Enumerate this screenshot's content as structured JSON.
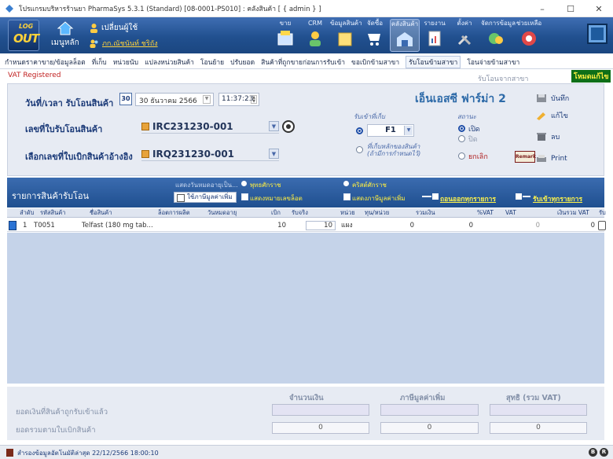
{
  "window": {
    "title": "โปรแกรมบริหารร้านยา PharmaSys 5.3.1 (Standard) [08-0001-PS010] : คลังสินค้า [ { admin } ]",
    "controls": {
      "minimize": "–",
      "maximize": "☐",
      "close": "✕"
    }
  },
  "toolbar": {
    "logout": {
      "line1": "LOG",
      "line2": "OUT"
    },
    "home_label": "เมนูหลัก",
    "change_user": "เปลี่ยนผู้ใช้",
    "current_user": "ภก.ณัชนันท์ ชริถัง",
    "buttons": [
      {
        "label": "ขาย",
        "icon": "sales-icon"
      },
      {
        "label": "CRM",
        "icon": "crm-icon"
      },
      {
        "label": "ข้อมูลสินค้า",
        "icon": "product-icon"
      },
      {
        "label": "จัดซื้อ",
        "icon": "purchase-icon"
      },
      {
        "label": "คลังสินค้า",
        "icon": "warehouse-icon"
      },
      {
        "label": "รายงาน",
        "icon": "report-icon"
      },
      {
        "label": "ตั้งค่า",
        "icon": "settings-icon"
      },
      {
        "label": "จัดการข้อมูล",
        "icon": "data-manage-icon"
      },
      {
        "label": "ช่วยเหลือ",
        "icon": "help-icon"
      }
    ]
  },
  "menu": [
    "กำหนดราคาขาย/ข้อมูลล็อต",
    "ที่เก็บ",
    "หน่วยนับ",
    "แปลงหน่วยสินค้า",
    "โอนย้าย",
    "ปรับยอด",
    "สินค้าที่ถูกขายก่อนการรับเข้า",
    "ขอเบิกข้ามสาขา",
    "รับโอนข้ามสาขา",
    "โอนจ่ายข้ามสาขา"
  ],
  "page": {
    "vat_registered": "VAT Registered",
    "transfer_from": "รับโอนจากสาขา",
    "edit_mode": "โหมดแก้ไข"
  },
  "form": {
    "datetime_label": "วันที่/เวลา รับโอนสินค้า",
    "calendar_day": "30",
    "date_value": "30   ธันวาคม   2566",
    "time_value": "11:37:23",
    "doc_no_label": "เลขที่ใบรับโอนสินค้า",
    "doc_no_value": "IRC231230-001",
    "ref_label": "เลือกเลขที่ใบเบิกสินค้าอ้างอิง",
    "ref_value": "IRQ231230-001",
    "branch_name": "เอ็นเอสซี ฟาร์ม่า 2",
    "store_to_label": "รับเข้าที่เก็บ",
    "warehouse_value": "F1",
    "default_store_line1": "ที่เก็บหลักของสินค้า",
    "default_store_line2": "(ถ้ามีการกำหนดไว้)",
    "status_label": "สถานะ",
    "status_open": "เปิด",
    "status_closed": "ปิด",
    "status_cancel": "ยกเลิก",
    "remark": "Remark"
  },
  "actions": {
    "save": "บันทึก",
    "edit": "แก้ไข",
    "delete": "ลบ",
    "print": "Print"
  },
  "items_bar": {
    "title": "รายการสินค้ารับโอน",
    "expiry_display": "แสดงวันหมดอายุเป็น...",
    "buddhist_era": "พุทธศักราช",
    "christian_era": "คริสต์ศักราช",
    "use_vat": "ใช้ภาษีมูลค่าเพิ่ม",
    "show_lot": "แสดงหมายเลขล็อต",
    "show_vat": "แสดงภาษีมูลค่าเพิ่ม",
    "remove_all": "ถอนออกทุกรายการ",
    "receive_all": "รับเข้าทุกรายการ"
  },
  "table": {
    "columns": [
      "ลำดับ",
      "รหัสสินค้า",
      "ชื่อสินค้า",
      "ล็อตการผลิต",
      "วันหมดอายุ",
      "เบิก",
      "รับจริง",
      "หน่วย",
      "ทุน/หน่วย",
      "รวมเงิน",
      "%VAT",
      "VAT",
      "เงินรวม VAT",
      "รับ"
    ],
    "rows": [
      {
        "seq": "1",
        "code": "T0051",
        "name": "Telfast (180 mg tab...",
        "lot": "",
        "expiry": "",
        "requested": "10",
        "received": "10",
        "unit": "แผง",
        "cost": "0",
        "amount": "0",
        "vat_pct": "",
        "vat": "0",
        "total_vat": "0"
      }
    ]
  },
  "totals": {
    "amount_header": "จำนวนเงิน",
    "vat_header": "ภาษีมูลค่าเพิ่ม",
    "net_header": "สุทธิ (รวม VAT)",
    "received_label": "ยอดเงินที่สินค้าถูกรับเข้าแล้ว",
    "requisition_label": "ยอดรวมตามใบเบิกสินค้า",
    "received_amount": "",
    "received_vat": "",
    "received_net": "",
    "req_amount": "0",
    "req_vat": "0",
    "req_net": "0"
  },
  "statusbar": {
    "text": "สำรองข้อมูลอัตโนมัติล่าสุด  22/12/2566 18:00:10",
    "b1": "B",
    "b2": "R"
  }
}
